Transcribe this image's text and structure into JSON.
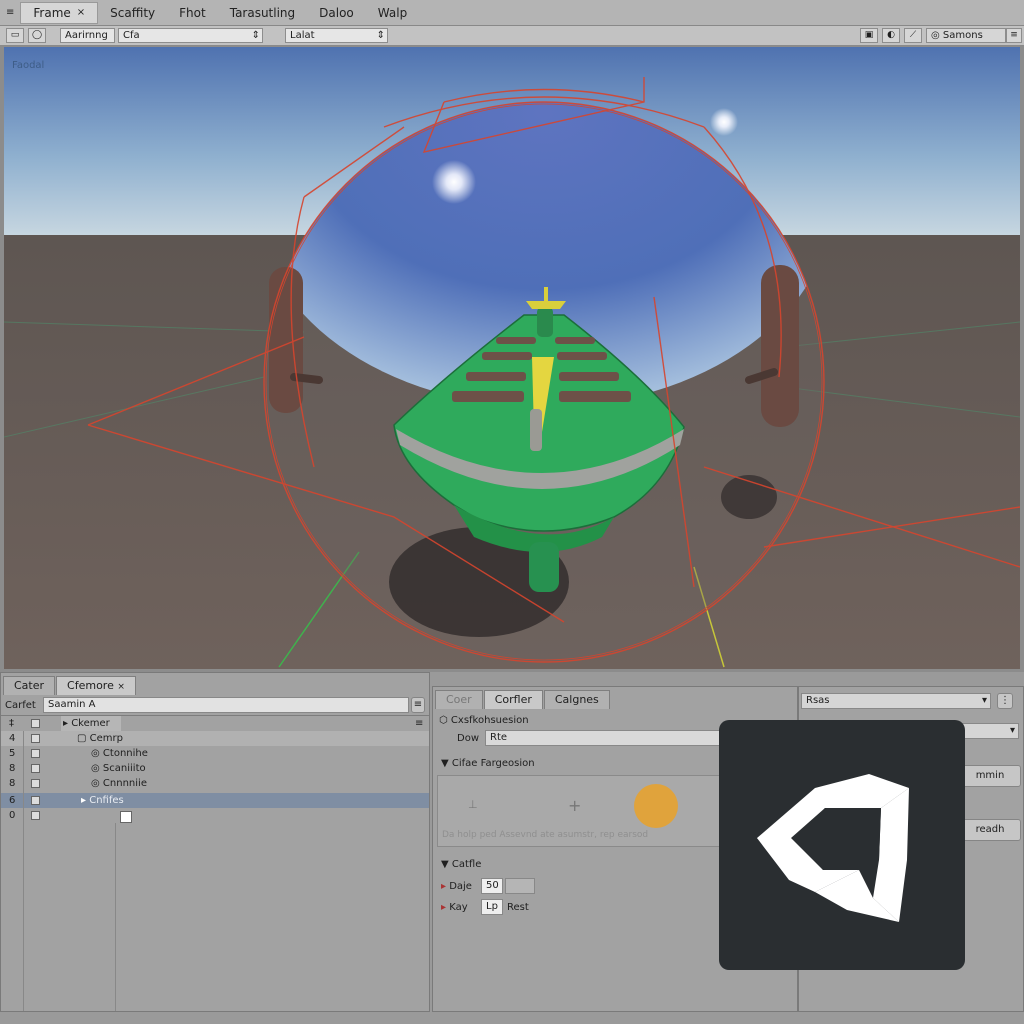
{
  "menubar": {
    "items": [
      "Frame",
      "Scaffity",
      "Fhot",
      "Tarasutling",
      "Daloo",
      "Walp"
    ],
    "active_close": "×"
  },
  "toolbar": {
    "field_a_label": "Aarirnng",
    "field_a_value": "Cfa",
    "field_b_value": "Lalat",
    "right_label": "Samons"
  },
  "scene": {
    "label": "Faodal"
  },
  "hierarchy": {
    "tabs": [
      "Cater",
      "Cfemore"
    ],
    "search_label": "Carfet",
    "search_value": "Saamin A",
    "header_label": "Ckemer",
    "rows": [
      {
        "num": "4",
        "label": "Cemrp"
      },
      {
        "num": "5",
        "label": "Ctonnihe"
      },
      {
        "num": "8",
        "label": "Scaniiito"
      },
      {
        "num": "8",
        "label": "Cnnnniie"
      },
      {
        "num": "6",
        "label": "Cnfifes"
      },
      {
        "num": "0",
        "label": ""
      }
    ]
  },
  "inspector": {
    "tabs": [
      "Coer",
      "Corfler",
      "Calgnes"
    ],
    "object_name": "Cxsfkohsuesion",
    "dor_label": "Dow",
    "dor_value": "Rte",
    "section1": "Cifae Fargeosion",
    "hint_text": "Da holp ped Assevnd ate asumstr, rep earsod",
    "section2": "Catfle",
    "prop1_label": "Daje",
    "prop1_value": "50",
    "prop2_label": "Kay",
    "prop2_value": "Lp",
    "prop2_extra": "Rest"
  },
  "right_panel": {
    "dropdown_value": "Rsas",
    "btn1": "mmin",
    "btn2": "readh"
  },
  "colors": {
    "scene_sky_top": "#5a79b4",
    "ground": "#6b5f5a",
    "boat": "#2faa5c",
    "sphere_lines": "#d44a36",
    "logo_bg": "#2a2e31"
  }
}
